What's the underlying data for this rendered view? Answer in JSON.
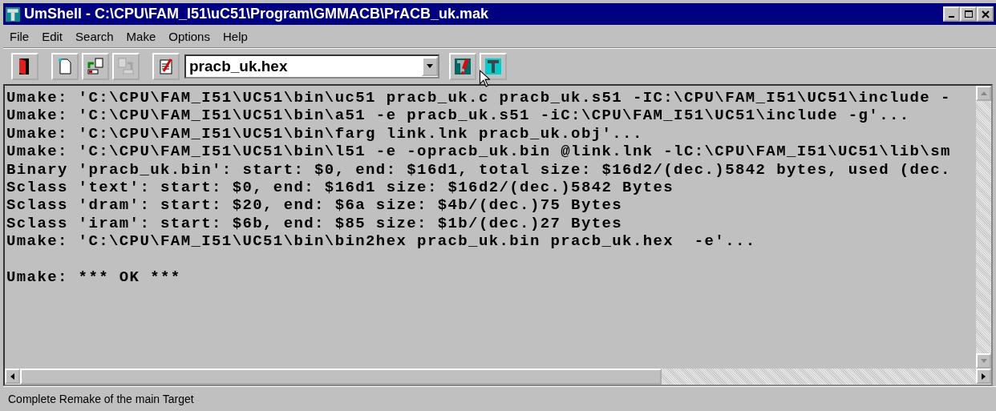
{
  "window": {
    "title": "UmShell - C:\\CPU\\FAM_I51\\uC51\\Program\\GMMACB\\PrACB_uk.mak"
  },
  "menu": [
    "File",
    "Edit",
    "Search",
    "Make",
    "Options",
    "Help"
  ],
  "toolbar": {
    "left": [
      {
        "kind": "exit",
        "disabled": false
      },
      {
        "kind": "sep"
      },
      {
        "kind": "new",
        "disabled": false
      },
      {
        "kind": "export",
        "disabled": false
      },
      {
        "kind": "import",
        "disabled": true
      },
      {
        "kind": "sep"
      },
      {
        "kind": "edit",
        "disabled": false
      }
    ],
    "target": {
      "value": "pracb_uk.hex"
    },
    "right": [
      {
        "kind": "remake",
        "disabled": false
      },
      {
        "kind": "make",
        "disabled": false
      }
    ]
  },
  "output": [
    "Umake: 'C:\\CPU\\FAM_I51\\UC51\\bin\\uc51 pracb_uk.c pracb_uk.s51 -IC:\\CPU\\FAM_I51\\UC51\\include -",
    "Umake: 'C:\\CPU\\FAM_I51\\UC51\\bin\\a51 -e pracb_uk.s51 -iC:\\CPU\\FAM_I51\\UC51\\include -g'...",
    "Umake: 'C:\\CPU\\FAM_I51\\UC51\\bin\\farg link.lnk pracb_uk.obj'...",
    "Umake: 'C:\\CPU\\FAM_I51\\UC51\\bin\\l51 -e -opracb_uk.bin @link.lnk -lC:\\CPU\\FAM_I51\\UC51\\lib\\sm",
    "Binary 'pracb_uk.bin': start: $0, end: $16d1, total size: $16d2/(dec.)5842 bytes, used (dec.",
    "Sclass 'text': start: $0, end: $16d1 size: $16d2/(dec.)5842 Bytes",
    "Sclass 'dram': start: $20, end: $6a size: $4b/(dec.)75 Bytes",
    "Sclass 'iram': start: $6b, end: $85 size: $1b/(dec.)27 Bytes",
    "Umake: 'C:\\CPU\\FAM_I51\\UC51\\bin\\bin2hex pracb_uk.bin pracb_uk.hex  -e'..."
  ],
  "result": "Umake: *** OK ***",
  "status_bar": "Complete Remake of the main Target"
}
